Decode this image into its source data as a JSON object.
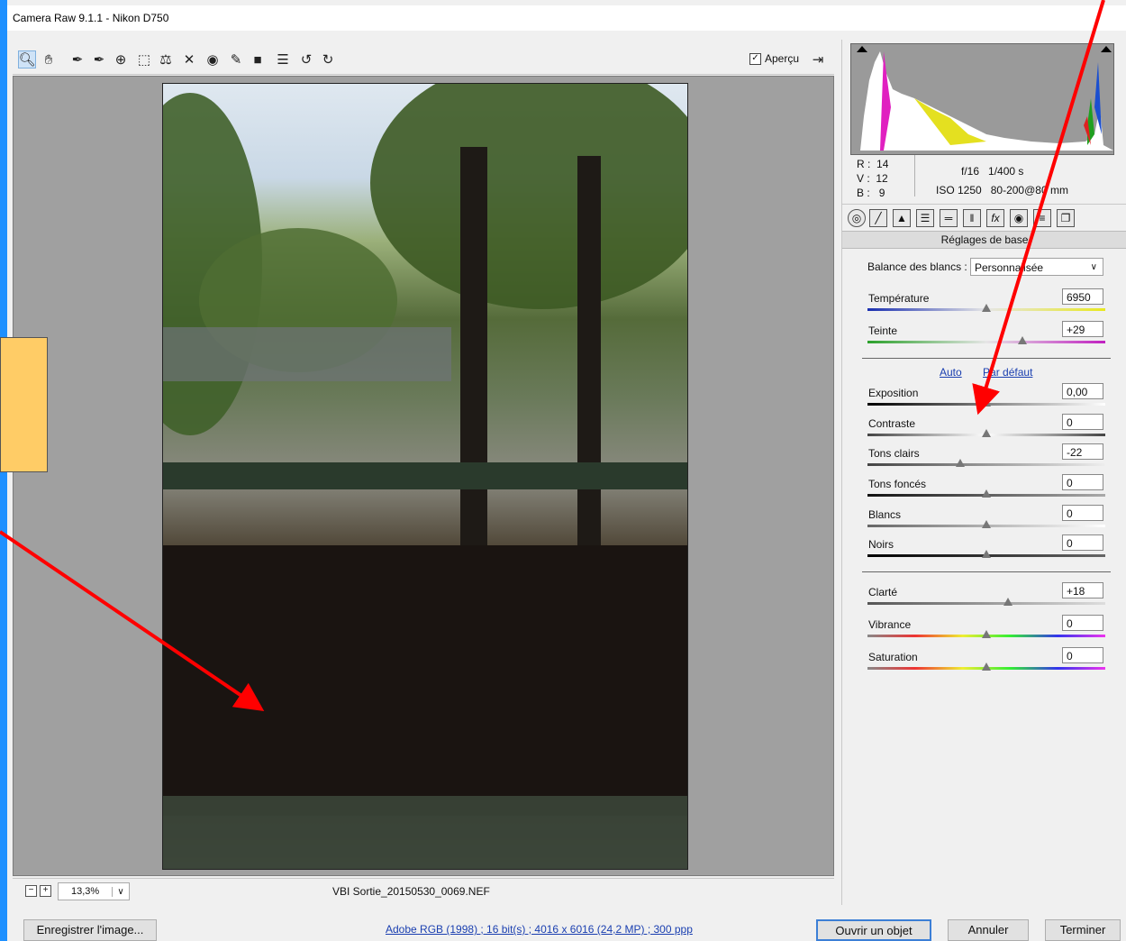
{
  "window": {
    "title": "Camera Raw 9.1.1  -  Nikon D750"
  },
  "toolbar": {
    "tools": [
      "zoom-tool",
      "hand-tool",
      "white-balance-tool",
      "color-sampler-tool",
      "targeted-adjustment-tool",
      "crop-tool",
      "straighten-tool",
      "spot-removal-tool",
      "red-eye-removal-tool",
      "adjustment-brush-tool",
      "graduated-filter-tool",
      "preferences",
      "rotate-ccw",
      "rotate-cw"
    ],
    "preview_label": "Aperçu",
    "preview_checked": true
  },
  "status_bar": {
    "zoom_value": "13,3%",
    "filename": "VBI Sortie_20150530_0069.NEF"
  },
  "info": {
    "r_label": "R :",
    "r_value": "14",
    "v_label": "V :",
    "v_value": "12",
    "b_label": "B :",
    "b_value": "9",
    "aperture": "f/16",
    "shutter": "1/400 s",
    "iso": "ISO 1250",
    "lens": "80-200@80 mm"
  },
  "panel": {
    "header": "Réglages de base",
    "white_balance_label": "Balance des blancs :",
    "white_balance_value": "Personnalisée",
    "auto_label": "Auto",
    "default_label": "Par défaut",
    "sliders": [
      {
        "label": "Température",
        "value": "6950",
        "position": 0.5
      },
      {
        "label": "Teinte",
        "value": "+29",
        "position": 0.65
      },
      {
        "label": "Exposition",
        "value": "0,00",
        "position": 0.5
      },
      {
        "label": "Contraste",
        "value": "0",
        "position": 0.5
      },
      {
        "label": "Tons clairs",
        "value": "-22",
        "position": 0.39
      },
      {
        "label": "Tons foncés",
        "value": "0",
        "position": 0.5
      },
      {
        "label": "Blancs",
        "value": "0",
        "position": 0.5
      },
      {
        "label": "Noirs",
        "value": "0",
        "position": 0.5
      },
      {
        "label": "Clarté",
        "value": "+18",
        "position": 0.59
      },
      {
        "label": "Vibrance",
        "value": "0",
        "position": 0.5
      },
      {
        "label": "Saturation",
        "value": "0",
        "position": 0.5
      }
    ]
  },
  "bottom": {
    "save_label": "Enregistrer l'image...",
    "workflow_link": "Adobe RGB (1998) ; 16 bit(s) ; 4016 x 6016 (24,2 MP) ; 300 ppp",
    "open_label": "Ouvrir un objet",
    "cancel_label": "Annuler",
    "done_label": "Terminer"
  },
  "colors": {
    "accent_blue": "#1e90ff",
    "callout": "#ffcc66",
    "arrow": "#ff0000"
  }
}
